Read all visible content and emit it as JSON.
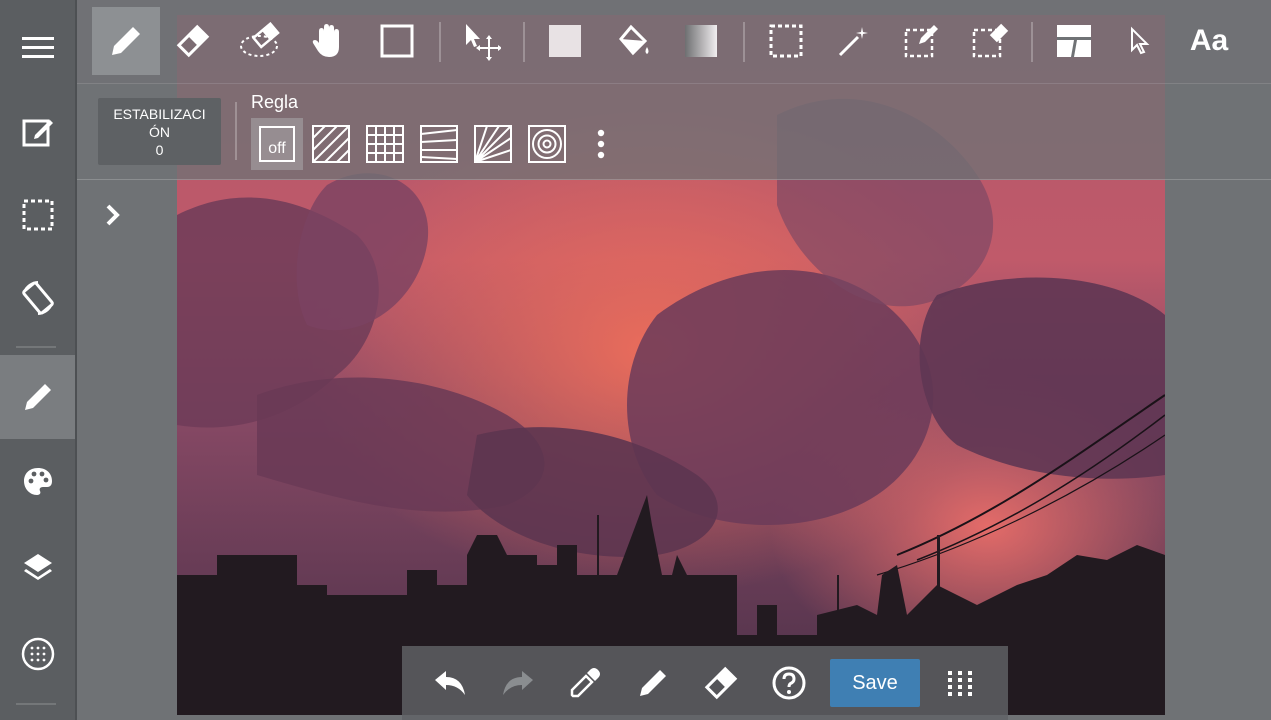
{
  "toolbar": {
    "tools": [
      "pencil-tool",
      "eraser-tool",
      "blur-eraser-tool",
      "hand-tool",
      "rectangle-tool",
      "move-tool",
      "fill-color-tool",
      "bucket-fill-tool",
      "gradient-tool",
      "select-rect-tool",
      "magic-wand-tool",
      "select-pen-tool",
      "select-eraser-tool",
      "panel-layout-tool",
      "pointer-tool"
    ],
    "text_tool_label": "Aa"
  },
  "subbar": {
    "stabilization_line1": "ESTABILIZACI",
    "stabilization_line2": "ÓN",
    "stabilization_value": "0",
    "ruler_title": "Regla",
    "ruler_off_label": "off"
  },
  "bottom": {
    "save_label": "Save"
  },
  "colors": {
    "accent": "#3f7fb3",
    "panel": "#6f7275",
    "sidebar": "#5b5e61"
  }
}
